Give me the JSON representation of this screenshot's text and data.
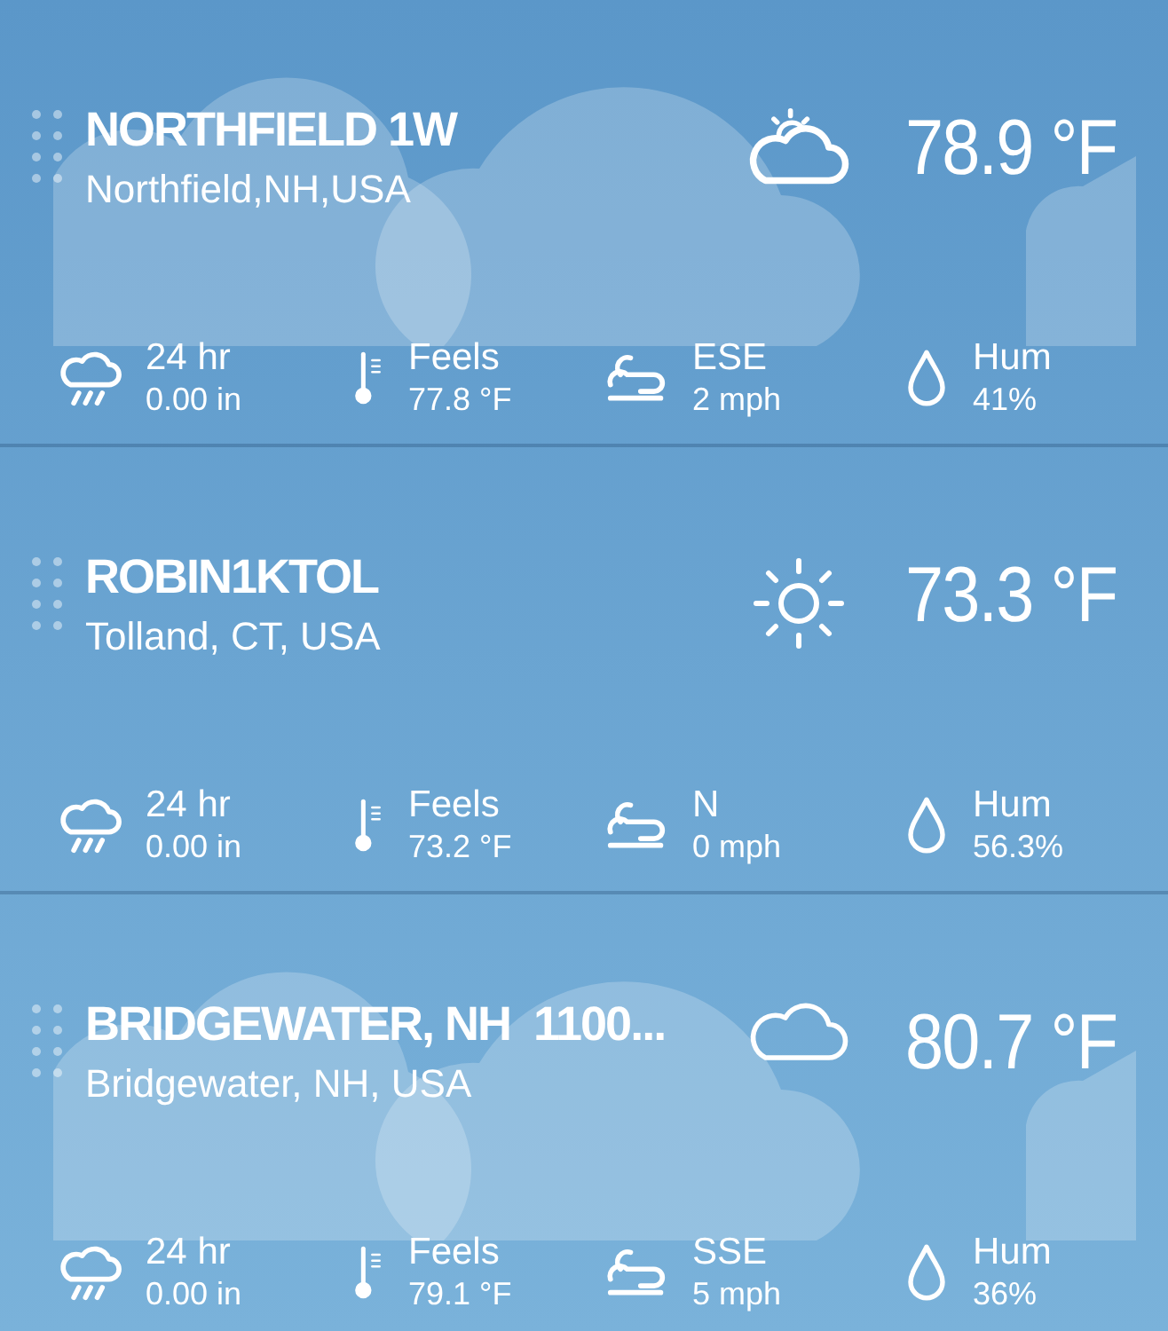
{
  "stations": [
    {
      "name": "NORTHFIELD 1W",
      "location": "Northfield,NH,USA",
      "kind": "partly-cloudy",
      "temperature": "78.9 °F",
      "stats": [
        {
          "kind": "rain",
          "label": "24 hr",
          "value": "0.00 in"
        },
        {
          "kind": "feels",
          "label": "Feels",
          "value": "77.8 °F"
        },
        {
          "kind": "wind",
          "label": "ESE",
          "value": "2 mph"
        },
        {
          "kind": "humidity",
          "label": "Hum",
          "value": "41%"
        }
      ]
    },
    {
      "name": "ROBIN1KTOL",
      "location": "Tolland, CT, USA",
      "kind": "sunny",
      "temperature": "73.3 °F",
      "stats": [
        {
          "kind": "rain",
          "label": "24 hr",
          "value": "0.00 in"
        },
        {
          "kind": "feels",
          "label": "Feels",
          "value": "73.2 °F"
        },
        {
          "kind": "wind",
          "label": "N",
          "value": "0 mph"
        },
        {
          "kind": "humidity",
          "label": "Hum",
          "value": "56.3%"
        }
      ]
    },
    {
      "name": "BRIDGEWATER, NH  1100...",
      "location": "Bridgewater, NH, USA",
      "kind": "cloudy",
      "temperature": "80.7 °F",
      "stats": [
        {
          "kind": "rain",
          "label": "24 hr",
          "value": "0.00 in"
        },
        {
          "kind": "feels",
          "label": "Feels",
          "value": "79.1 °F"
        },
        {
          "kind": "wind",
          "label": "SSE",
          "value": "5 mph"
        },
        {
          "kind": "humidity",
          "label": "Hum",
          "value": "36%"
        }
      ]
    }
  ]
}
